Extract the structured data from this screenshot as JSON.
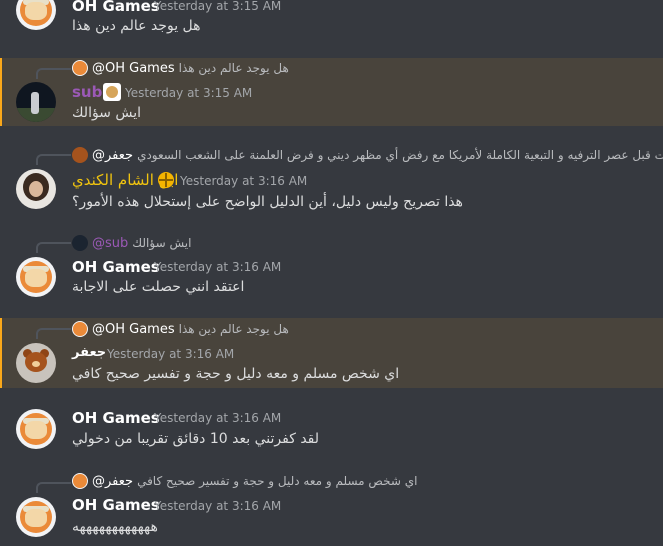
{
  "messages": [
    {
      "author": "OH Games",
      "timestamp": "Yesterday at 3:15 AM",
      "text": "هل يوجد عالم دين هذا"
    },
    {
      "reply_to": {
        "author": "@OH Games",
        "text": "هل يوجد عالم دين هذا"
      },
      "author": "sub",
      "timestamp": "Yesterday at 3:15 AM",
      "text": "ايش سؤالك"
    },
    {
      "reply_to": {
        "author": "@جعفر",
        "text": "كانت قبل عصر الترفيه و التبعية الكاملة لأمريكا مع رفض أي مظهر ديني و فرض العلمنة على الشعب السعودي"
      },
      "author": "ابن الشام الكندي",
      "timestamp": "Yesterday at 3:16 AM",
      "text": "هذا تصريح وليس دليل، أين الدليل الواضح على إستحلال هذه الأمور؟"
    },
    {
      "reply_to": {
        "author": "@sub",
        "text": "ايش سؤالك"
      },
      "author": "OH Games",
      "timestamp": "Yesterday at 3:16 AM",
      "text": "اعتقد انني حصلت على الاجابة"
    },
    {
      "reply_to": {
        "author": "@OH Games",
        "text": "هل يوجد عالم دين هذا"
      },
      "author": "جعفر",
      "timestamp": "Yesterday at 3:16 AM",
      "text": "اي شخص مسلم و معه دليل و حجة و تفسير صحيح كافي"
    },
    {
      "author": "OH Games",
      "timestamp": "Yesterday at 3:16 AM",
      "text": "لقد كفرتني بعد 10 دقائق تقريبا من دخولي"
    },
    {
      "reply_to": {
        "author": "@جعفر",
        "text": "اي شخص مسلم و معه دليل و حجة و تفسير صحيح كافي"
      },
      "author": "OH Games",
      "timestamp": "Yesterday at 3:16 AM",
      "text": "ههههههههههههه"
    }
  ],
  "colors": {
    "background": "#36393f",
    "highlight": "#49443c",
    "highlight_bar": "#faa81a",
    "sub_name": "#9b59b6",
    "sham_name": "#f1c40f"
  }
}
